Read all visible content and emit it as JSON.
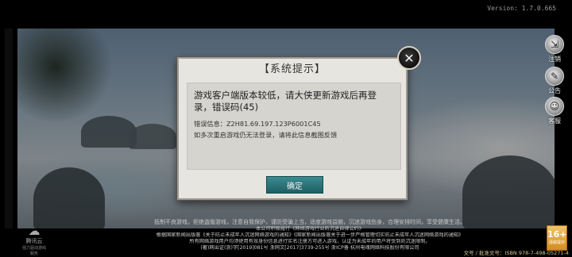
{
  "version": "Version: 1.7.0.665",
  "side_menu": [
    {
      "icon": "logout-icon",
      "label": "注销"
    },
    {
      "icon": "announcement-icon",
      "label": "公告"
    },
    {
      "icon": "customer-service-icon",
      "label": "客服"
    }
  ],
  "dialog": {
    "title": "【系统提示】",
    "message": "游戏客户端版本较低，请大侠更新游戏后再登录，错误码(45)",
    "error_info": "错误信息：Z2H81.69.197.123P6001C45",
    "hint": "如多次重启游戏仍无法登录，请将此信息截图反馈",
    "confirm_label": "确定"
  },
  "bottom_text": {
    "line1": "抵制不良游戏，拒绝盗版游戏，注意自我保护，谨防受骗上当，适度游戏益脑，沉迷游戏伤身，合理安排时间，享受健康生活。",
    "line2": "本公司积极履行《网络游戏行业防沉迷自律公约》",
    "line3": "根据国家新闻出版署《关于防止未成年人沉迷网络游戏的通知》《国家新闻出版署关于进一步严格管理切实防止未成年人沉迷网络游戏的通知》",
    "line4": "所有网络游戏用户均须使用有效身份信息进行实名注册方可进入游戏，认证为未成年的用户将受到防沉迷限制。",
    "line5": "(著)网出证(浙)字[2019]081号  浙网文[2017]3739-255号  浙ICP备  杭州电魂网络科技股份有限公司"
  },
  "cloud_logo": {
    "title": "腾讯云",
    "subtitle": "强力驱动游戏服务"
  },
  "age_badge": {
    "age": "16+",
    "caption": "适龄提示"
  },
  "license": "文号 / 批准文号：ISBN 978-7-498-05271-4"
}
